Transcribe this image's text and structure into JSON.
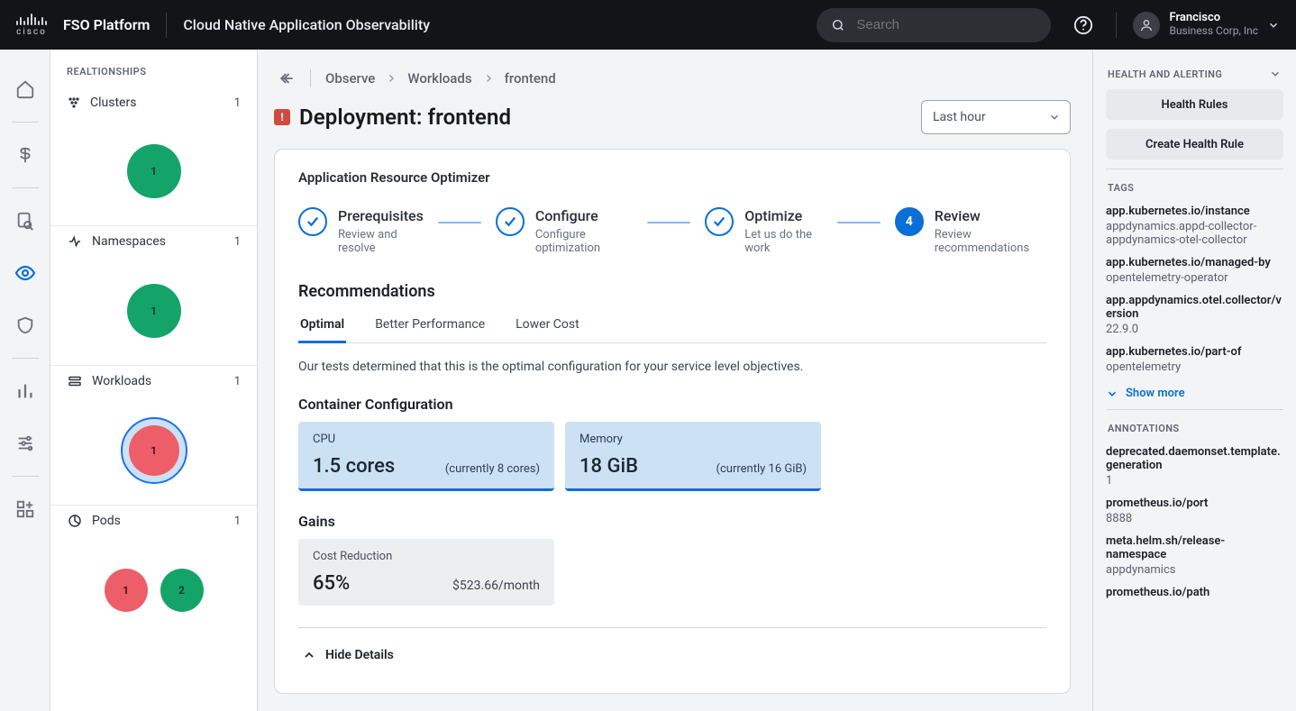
{
  "header": {
    "brand": "FSO Platform",
    "sub": "Cloud Native Application Observability",
    "search_placeholder": "Search",
    "user": {
      "name": "Francisco",
      "org": "Business Corp, Inc"
    }
  },
  "relationships": {
    "title": "REALTIONSHIPS",
    "groups": [
      {
        "label": "Clusters",
        "count": "1",
        "bubbles": [
          {
            "color": "green",
            "size": 60,
            "n": "1"
          }
        ]
      },
      {
        "label": "Namespaces",
        "count": "1",
        "bubbles": [
          {
            "color": "green",
            "size": 60,
            "n": "1"
          }
        ]
      },
      {
        "label": "Workloads",
        "count": "1",
        "bubbles": [
          {
            "color": "red",
            "size": 56,
            "n": "1",
            "ring": true
          }
        ]
      },
      {
        "label": "Pods",
        "count": "1",
        "bubbles": [
          {
            "color": "red",
            "size": 48,
            "n": "1"
          },
          {
            "color": "green",
            "size": 48,
            "n": "2"
          }
        ]
      }
    ]
  },
  "breadcrumbs": [
    "Observe",
    "Workloads",
    "frontend"
  ],
  "title": "Deployment: frontend",
  "time": "Last hour",
  "optimizer": {
    "title": "Application Resource Optimizer",
    "steps": [
      {
        "t": "Prerequisites",
        "s": "Review and resolve",
        "done": true
      },
      {
        "t": "Configure",
        "s": "Configure optimization",
        "done": true
      },
      {
        "t": "Optimize",
        "s": "Let us do the work",
        "done": true
      },
      {
        "t": "Review",
        "s": "Review recommendations",
        "done": false,
        "num": "4"
      }
    ],
    "recommendations_h": "Recommendations",
    "tabs": [
      "Optimal",
      "Better Performance",
      "Lower Cost"
    ],
    "active_tab": 0,
    "desc": "Our tests determined that this is the optimal configuration for your service level objectives.",
    "cfg_h": "Container Configuration",
    "cards": [
      {
        "t": "CPU",
        "val": "1.5 cores",
        "cur": "(currently 8 cores)"
      },
      {
        "t": "Memory",
        "val": "18 GiB",
        "cur": "(currently 16 GiB)"
      }
    ],
    "gains_h": "Gains",
    "gains": [
      {
        "t": "Cost Reduction",
        "val": "65%",
        "per": "$523.66/month"
      }
    ],
    "hide": "Hide  Details"
  },
  "right": {
    "health_h": "HEALTH AND ALERTING",
    "btn1": "Health Rules",
    "btn2": "Create Health Rule",
    "tags_h": "TAGS",
    "tags": [
      {
        "k": "app.kubernetes.io/instance",
        "v": "appdynamics.appd-collector-appdynamics-otel-collector"
      },
      {
        "k": "app.kubernetes.io/managed-by",
        "v": "opentelemetry-operator"
      },
      {
        "k": "app.appdynamics.otel.collector/version",
        "v": "22.9.0"
      },
      {
        "k": "app.kubernetes.io/part-of",
        "v": "opentelemetry"
      }
    ],
    "show_more": "Show more",
    "ann_h": "ANNOTATIONS",
    "annotations": [
      {
        "k": "deprecated.daemonset.template.generation",
        "v": "1"
      },
      {
        "k": "prometheus.io/port",
        "v": "8888"
      },
      {
        "k": "meta.helm.sh/release-namespace",
        "v": "appdynamics"
      },
      {
        "k": "prometheus.io/path",
        "v": ""
      }
    ]
  }
}
